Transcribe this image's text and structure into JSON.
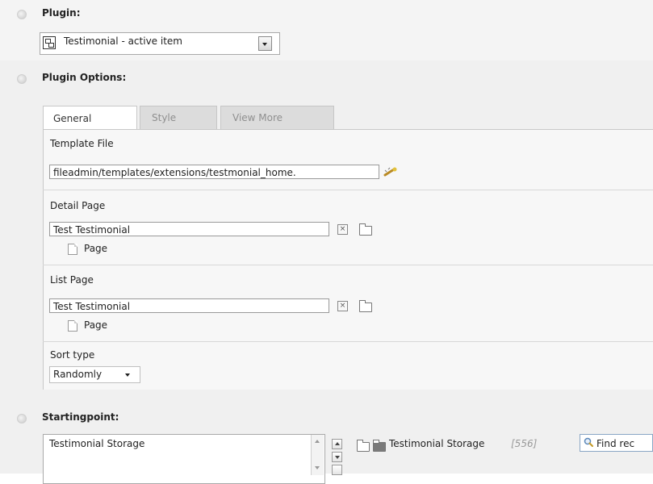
{
  "plugin": {
    "section_title": "Plugin:",
    "select_value": "Testimonial - active item",
    "plugin_icon": "plugin-icon"
  },
  "plugin_options": {
    "section_title": "Plugin Options:",
    "tabs": [
      {
        "label": "General",
        "active": true
      },
      {
        "label": "Style",
        "active": false
      },
      {
        "label": "View More",
        "active": false
      }
    ],
    "template_file": {
      "label": "Template File",
      "value": "fileadmin/templates/extensions/testmonial_home."
    },
    "detail_page": {
      "label": "Detail Page",
      "value": "Test Testimonial",
      "type_label": "Page"
    },
    "list_page": {
      "label": "List Page",
      "value": "Test Testimonial",
      "type_label": "Page"
    },
    "sort_type": {
      "label": "Sort type",
      "value": "Randomly"
    }
  },
  "startingpoint": {
    "section_title": "Startingpoint:",
    "selected_item": "Testimonial Storage",
    "record_name": "Testimonial Storage",
    "record_id": "[556]",
    "find_placeholder": "Find rec"
  },
  "colors": {
    "band": "#f0f0f0",
    "inner_panel": "#f7f7f7",
    "inactive_tab": "#dcdcdc"
  }
}
